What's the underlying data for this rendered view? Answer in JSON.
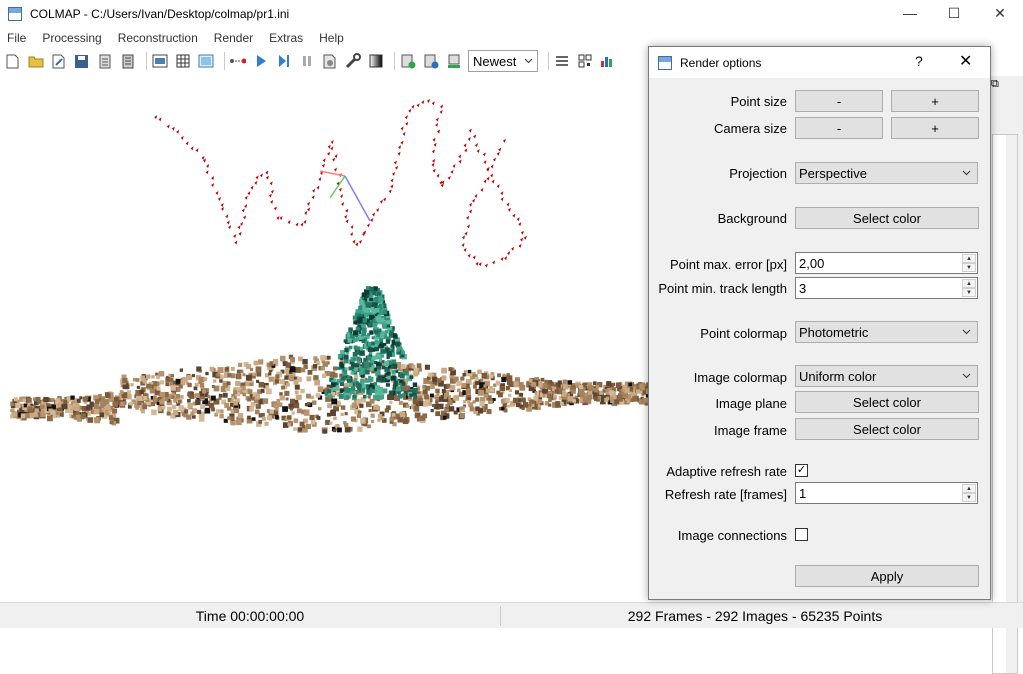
{
  "window": {
    "title": "COLMAP - C:/Users/Ivan/Desktop/colmap/pr1.ini",
    "minimize": "—",
    "maximize": "☐",
    "close": "✕"
  },
  "menu": [
    "File",
    "Processing",
    "Reconstruction",
    "Render",
    "Extras",
    "Help"
  ],
  "toolbar": {
    "combo_value": "Newest"
  },
  "status": {
    "time": "Time 00:00:00:00",
    "summary": "292 Frames - 292 Images - 65235 Points"
  },
  "dialog": {
    "title": "Render options",
    "help": "?",
    "close": "✕",
    "point_size": {
      "label": "Point size",
      "minus": "-",
      "plus": "+"
    },
    "camera_size": {
      "label": "Camera size",
      "minus": "-",
      "plus": "+"
    },
    "projection": {
      "label": "Projection",
      "value": "Perspective"
    },
    "background": {
      "label": "Background",
      "button": "Select color"
    },
    "point_max_error": {
      "label": "Point max. error [px]",
      "value": "2,00"
    },
    "point_min_track": {
      "label": "Point min. track length",
      "value": "3"
    },
    "point_colormap": {
      "label": "Point colormap",
      "value": "Photometric"
    },
    "image_colormap": {
      "label": "Image colormap",
      "value": "Uniform color"
    },
    "image_plane": {
      "label": "Image plane",
      "button": "Select color"
    },
    "image_frame": {
      "label": "Image frame",
      "button": "Select color"
    },
    "adaptive_refresh": {
      "label": "Adaptive refresh rate",
      "checked": true
    },
    "refresh_rate": {
      "label": "Refresh rate [frames]",
      "value": "1"
    },
    "image_connections": {
      "label": "Image connections",
      "checked": false
    },
    "apply": "Apply"
  },
  "colors": {
    "camera_red": "#c00000",
    "ground": "#a5835f",
    "tree": "#1f6b5c"
  }
}
